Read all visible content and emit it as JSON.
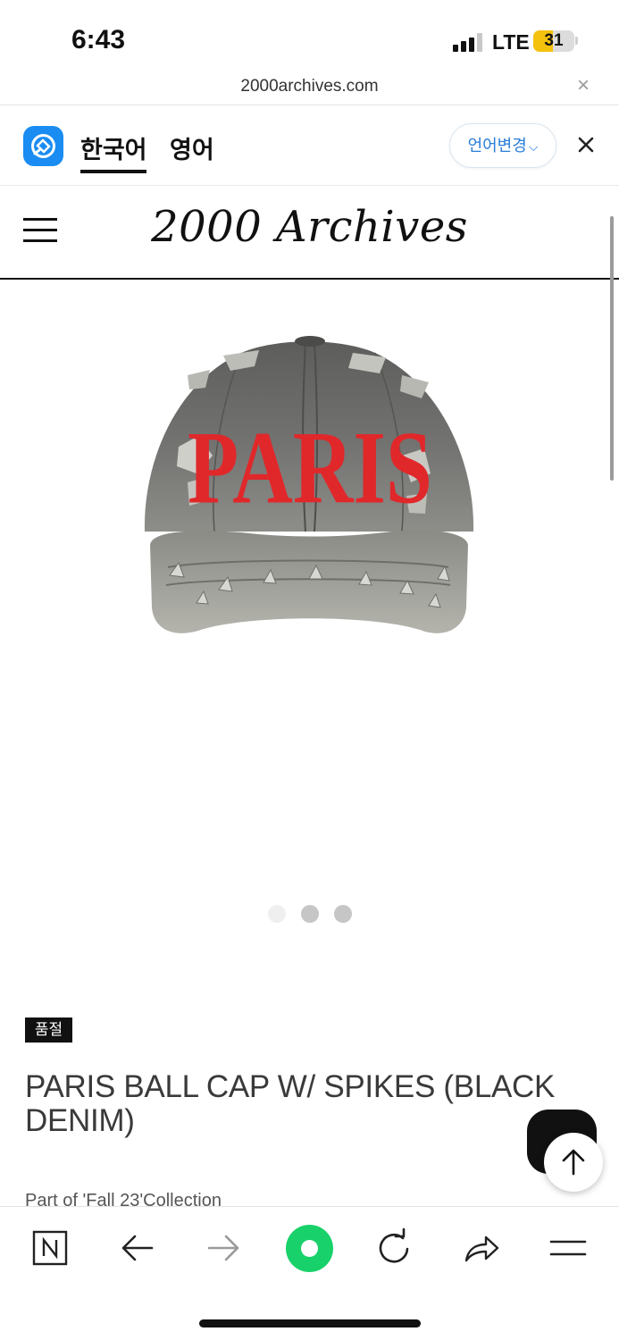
{
  "status_bar": {
    "time": "6:43",
    "network": "LTE",
    "battery": "31",
    "battery_color": "#f4c20d"
  },
  "browser": {
    "url": "2000archives.com",
    "close_icon": "close-icon"
  },
  "translate_bar": {
    "source_lang": "한국어",
    "target_lang": "영어",
    "change_language_label": "언어변경",
    "accent_color": "#1a8cf2"
  },
  "site": {
    "logo": "2000 Archives"
  },
  "product": {
    "image_icon": "denim-cap-image",
    "image_text": "PARIS",
    "carousel": {
      "total": 3,
      "active": 1
    },
    "soldout_badge": "품절",
    "title": "PARIS BALL CAP W/ SPIKES (BLACK DENIM)",
    "collection_note": "Part of 'Fall 23'Collection"
  },
  "toolbar": {
    "items": [
      "naver-home-icon",
      "back-arrow-icon",
      "forward-arrow-icon",
      "green-action-button",
      "reload-icon",
      "share-icon",
      "menu-icon"
    ],
    "green_color": "#18d16a"
  }
}
